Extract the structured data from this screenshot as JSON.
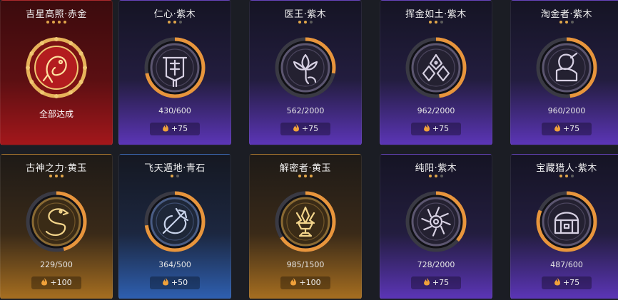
{
  "cards": [
    {
      "title": "吉星高照·赤金",
      "stars_total": 4,
      "stars_filled": 4,
      "theme": "red",
      "complete": true,
      "status_text": "全部达成",
      "progress_fraction": 1.0,
      "icon": "koi-fish-icon"
    },
    {
      "title": "仁心·紫木",
      "stars_total": 3,
      "stars_filled": 2,
      "theme": "purple",
      "progress_text": "430/600",
      "progress_fraction": 0.717,
      "reward": "+75",
      "icon": "banner-icon"
    },
    {
      "title": "医王·紫木",
      "stars_total": 3,
      "stars_filled": 2,
      "theme": "purple",
      "progress_text": "562/2000",
      "progress_fraction": 0.281,
      "reward": "+75",
      "icon": "lotus-icon"
    },
    {
      "title": "挥金如土·紫木",
      "stars_total": 3,
      "stars_filled": 2,
      "theme": "purple",
      "progress_text": "962/2000",
      "progress_fraction": 0.481,
      "reward": "+75",
      "icon": "gold-pile-icon"
    },
    {
      "title": "淘金者·紫木",
      "stars_total": 3,
      "stars_filled": 2,
      "theme": "purple",
      "progress_text": "960/2000",
      "progress_fraction": 0.48,
      "reward": "+75",
      "icon": "digger-icon"
    },
    {
      "title": "古神之力·黄玉",
      "stars_total": 3,
      "stars_filled": 3,
      "theme": "gold",
      "progress_text": "229/500",
      "progress_fraction": 0.458,
      "reward": "+100",
      "icon": "serpent-icon"
    },
    {
      "title": "飞天遁地·青石",
      "stars_total": 2,
      "stars_filled": 1,
      "theme": "blue",
      "progress_text": "364/500",
      "progress_fraction": 0.728,
      "reward": "+50",
      "icon": "trident-icon"
    },
    {
      "title": "解密者·黄玉",
      "stars_total": 3,
      "stars_filled": 3,
      "theme": "gold",
      "progress_text": "985/1500",
      "progress_fraction": 0.657,
      "reward": "+100",
      "icon": "crystal-chalice-icon"
    },
    {
      "title": "纯阳·紫木",
      "stars_total": 3,
      "stars_filled": 2,
      "theme": "purple",
      "progress_text": "728/2000",
      "progress_fraction": 0.364,
      "reward": "+75",
      "icon": "sun-icon"
    },
    {
      "title": "宝藏猎人·紫木",
      "stars_total": 3,
      "stars_filled": 2,
      "theme": "purple",
      "progress_text": "487/600",
      "progress_fraction": 0.812,
      "reward": "+75",
      "icon": "treasure-chest-icon"
    }
  ],
  "colors": {
    "progress_arc": "#e8953c",
    "star_on": "#e1a64a",
    "star_off": "#5b5b5b",
    "flame": "#f0a13a"
  }
}
